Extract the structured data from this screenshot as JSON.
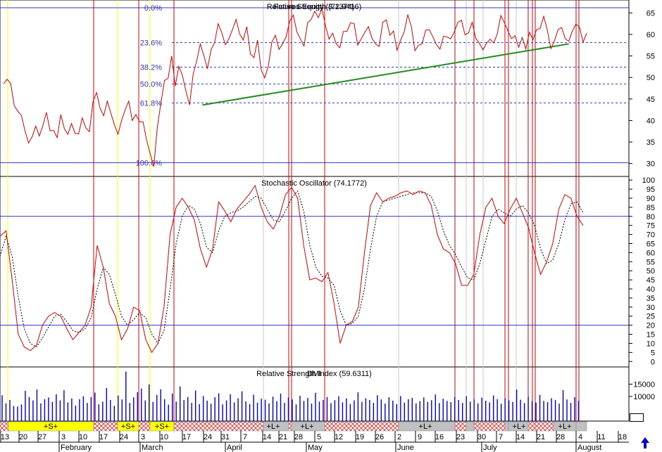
{
  "chart_data": [
    {
      "panel": "price",
      "type": "line",
      "titles": [
        "Relative Strength (72.9416)",
        "Futures Equity (3.1374)"
      ],
      "yticks": [
        65,
        60,
        55,
        50,
        45,
        40,
        35,
        30
      ],
      "ylim": [
        27,
        68
      ],
      "fib_levels": [
        {
          "label": "0.0%",
          "value": 66.2
        },
        {
          "label": "23.6%",
          "value": 58.1
        },
        {
          "label": "38.2%",
          "value": 52.4
        },
        {
          "label": "50.0%",
          "value": 48.5
        },
        {
          "label": "61.8%",
          "value": 44.1
        },
        {
          "label": "100.0%",
          "value": 30.2
        }
      ],
      "trendline": {
        "x": [
          55.6,
          158
        ],
        "y": [
          43.6,
          57.8
        ]
      },
      "series": [
        {
          "values": [
            48.5,
            49.6,
            48.6,
            43.5,
            42.1,
            41.2,
            37.6,
            34.8,
            36.2,
            38.7,
            36.4,
            38.8,
            41.9,
            37.6,
            37.7,
            36.0,
            41.4,
            38.1,
            36.8,
            39.3,
            37.0,
            36.9,
            40.6,
            38.3,
            37.4,
            44.3,
            46.5,
            42.8,
            41.1,
            44.5,
            41.7,
            39.0,
            36.8,
            40.0,
            42.5,
            44.5,
            40.0,
            41.4,
            39.7,
            39.7,
            35.4,
            32.2,
            29.3,
            38.5,
            44.1,
            49.3,
            49.8,
            55.0,
            48.0,
            52.6,
            50.5,
            46.8,
            43.6,
            50.7,
            53.9,
            57.8,
            55.1,
            52.0,
            56.4,
            58.1,
            62.5,
            60.4,
            57.6,
            59.0,
            61.1,
            63.5,
            60.1,
            58.7,
            61.8,
            55.5,
            54.6,
            58.7,
            51.8,
            49.9,
            52.6,
            58.2,
            59.8,
            56.5,
            57.8,
            59.5,
            63.1,
            64.5,
            60.6,
            58.9,
            57.3,
            62.7,
            63.5,
            65.4,
            63.9,
            66.0,
            62.0,
            58.9,
            60.3,
            57.8,
            56.9,
            60.7,
            60.7,
            62.7,
            62.5,
            57.5,
            59.0,
            60.5,
            61.8,
            59.1,
            57.8,
            57.2,
            62.8,
            63.4,
            59.8,
            60.8,
            56.3,
            58.7,
            60.6,
            64.6,
            61.8,
            56.2,
            57.5,
            57.8,
            61.0,
            61.1,
            59.5,
            57.6,
            56.6,
            59.6,
            59.4,
            59.0,
            60.6,
            62.8,
            63.3,
            59.9,
            60.4,
            62.8,
            59.1,
            58.0,
            56.4,
            57.9,
            58.9,
            58.0,
            60.1,
            64.4,
            62.7,
            60.8,
            59.0,
            59.7,
            57.0,
            59.3,
            56.6,
            60.5,
            58.8,
            61.1,
            61.4,
            64.2,
            61.0,
            56.7,
            58.5,
            61.1,
            61.6,
            59.0,
            58.4,
            60.8,
            62.4,
            61.7,
            58.2,
            60.3
          ]
        }
      ]
    },
    {
      "panel": "stochastic",
      "type": "line",
      "title": "Stochastic Oscillator (74.1772)",
      "yticks": [
        100,
        95,
        90,
        85,
        80,
        75,
        70,
        65,
        60,
        55,
        50,
        45,
        40,
        35,
        30,
        25,
        20,
        15,
        10,
        5,
        0
      ],
      "ylim": [
        -3,
        102
      ],
      "reference_lines": [
        80,
        20
      ],
      "series": [
        {
          "values": [
            69,
            72,
            45,
            15,
            8,
            6,
            9,
            20,
            25,
            27,
            25,
            18,
            12,
            16,
            20,
            30,
            64,
            52,
            32,
            25,
            12,
            18,
            30,
            28,
            12,
            5,
            10,
            30,
            70,
            85,
            90,
            85,
            78,
            62,
            52,
            62,
            88,
            83,
            77,
            84,
            88,
            92,
            97,
            85,
            77,
            73,
            80,
            92,
            96,
            90,
            64,
            45,
            46,
            44,
            49,
            32,
            10,
            20,
            22,
            30,
            60,
            86,
            93,
            88,
            90,
            91,
            93,
            94,
            92,
            94,
            93,
            86,
            70,
            62,
            60,
            54,
            42,
            42,
            48,
            70,
            85,
            90,
            80,
            76,
            84,
            90,
            82,
            74,
            60,
            48,
            55,
            65,
            84,
            92,
            90,
            80,
            75
          ]
        },
        {
          "values": [
            58,
            69,
            58,
            36,
            18,
            10,
            8,
            13,
            19,
            25,
            26,
            22,
            17,
            16,
            18,
            24,
            40,
            52,
            48,
            37,
            25,
            20,
            23,
            27,
            24,
            15,
            10,
            17,
            40,
            65,
            80,
            86,
            84,
            76,
            63,
            60,
            72,
            80,
            82,
            83,
            85,
            88,
            91,
            90,
            84,
            78,
            77,
            83,
            90,
            94,
            83,
            64,
            52,
            47,
            46,
            42,
            28,
            20,
            21,
            25,
            40,
            62,
            80,
            88,
            89,
            90,
            91,
            92,
            93,
            93,
            93,
            91,
            83,
            72,
            64,
            59,
            52,
            46,
            45,
            54,
            67,
            80,
            84,
            82,
            80,
            84,
            86,
            82,
            75,
            62,
            54,
            56,
            65,
            78,
            87,
            88,
            82
          ]
        }
      ]
    },
    {
      "panel": "volume",
      "type": "bar",
      "title": "Relative Strength Index (59.6311)",
      "subtitle": "DMI",
      "yticks": [
        15000,
        10000
      ],
      "ylim": [
        0,
        22000
      ],
      "values": [
        10500,
        7200,
        8600,
        6100,
        5900,
        6800,
        12300,
        9800,
        8400,
        12800,
        7200,
        8900,
        9600,
        7800,
        10900,
        8400,
        12600,
        7600,
        9200,
        6300,
        8900,
        10100,
        7400,
        9800,
        11600,
        6800,
        7900,
        13400,
        8600,
        6200,
        10400,
        8800,
        20100,
        7400,
        9600,
        11700,
        13200,
        8400,
        14900,
        7800,
        10600,
        12900,
        8900,
        6700,
        11200,
        7900,
        14100,
        8600,
        9800,
        7400,
        12400,
        6900,
        10200,
        8300,
        7100,
        9700,
        11300,
        6800,
        8400,
        10900,
        7600,
        9300,
        12100,
        8000,
        6900,
        10700,
        7500,
        9100,
        8700,
        7200,
        9900,
        8100,
        11200,
        7400,
        9600,
        8800,
        6800,
        10300,
        8200,
        9400,
        7100,
        11500,
        7900,
        8600,
        9800,
        7300,
        8500,
        10100,
        7600,
        9200,
        6900,
        8400,
        11700,
        7800,
        9300,
        8600,
        7400,
        10500,
        8800,
        7100,
        9700,
        8300,
        6900,
        10200,
        7500,
        8900,
        9400,
        7200,
        8100,
        9600,
        7800,
        8500,
        10800,
        7300,
        9100,
        8200,
        7700,
        9800,
        8600,
        7400,
        10100,
        7900,
        8800,
        7200,
        9500,
        8300,
        7600,
        10400,
        8900,
        7100,
        9200,
        8400,
        7800,
        12800,
        8700,
        7300,
        9900,
        8100,
        7500,
        10600,
        8200,
        7700,
        9300,
        8600,
        7100,
        12600,
        8800,
        7400,
        9700,
        8300
      ]
    }
  ],
  "x_axis": {
    "day_labels": [
      "13",
      "20",
      "27",
      "3",
      "10",
      "17",
      "24",
      "3",
      "10",
      "17",
      "24",
      "31",
      "7",
      "14",
      "21",
      "28",
      "5",
      "12",
      "19",
      "26",
      "2",
      "9",
      "16",
      "23",
      "30",
      "7",
      "14",
      "21",
      "28",
      "4",
      "11",
      "18"
    ],
    "month_labels": [
      "February",
      "March",
      "April",
      "May",
      "June",
      "July",
      "August"
    ]
  },
  "signal_bar": {
    "segments": [
      {
        "label": "+S+"
      },
      {
        "label": "+S+"
      },
      {
        "label": "+S+"
      },
      {
        "label": "+L+"
      },
      {
        "label": "+L+"
      },
      {
        "label": "+L+"
      },
      {
        "label": "+L+"
      },
      {
        "label": "+L+"
      }
    ]
  },
  "colors": {
    "red": "#dd0000",
    "yellow_line": "#ffff00",
    "blue_line": "#3333cc",
    "trend_green": "#228b22",
    "signal_yellow": "#ffff00",
    "signal_gray": "#c0c0c0",
    "hatch_red": "#dd4444"
  }
}
